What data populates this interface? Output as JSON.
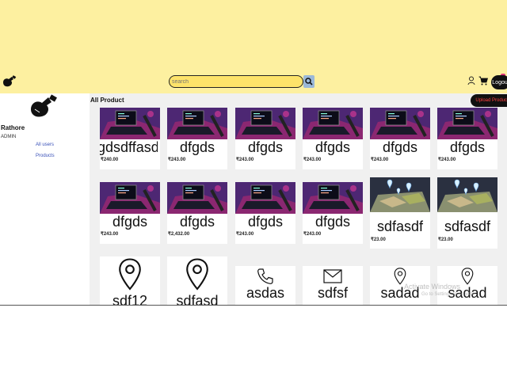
{
  "header": {
    "search_placeholder": "search",
    "logout_label": "Logout"
  },
  "sidebar": {
    "user_name": "Rathore",
    "user_role": "ADMIN",
    "links": [
      "All users",
      "Products"
    ]
  },
  "main": {
    "section_title": "All Product",
    "upload_label": "Upload Product"
  },
  "products": [
    {
      "name": "gdsdffasd",
      "price": "₹240.00",
      "image": "laptop-photo"
    },
    {
      "name": "dfgds",
      "price": "₹243.00",
      "image": "laptop-photo"
    },
    {
      "name": "dfgds",
      "price": "₹243.00",
      "image": "laptop-photo"
    },
    {
      "name": "dfgds",
      "price": "₹243.00",
      "image": "laptop-photo"
    },
    {
      "name": "dfgds",
      "price": "₹243.00",
      "image": "laptop-photo"
    },
    {
      "name": "dfgds",
      "price": "₹243.00",
      "image": "laptop-photo"
    },
    {
      "name": "dfgds",
      "price": "₹243.00",
      "image": "laptop-photo"
    },
    {
      "name": "dfgds",
      "price": "₹2,432.00",
      "image": "laptop-photo"
    },
    {
      "name": "dfgds",
      "price": "₹243.00",
      "image": "laptop-photo"
    },
    {
      "name": "dfgds",
      "price": "₹243.00",
      "image": "laptop-photo"
    },
    {
      "name": "sdfasdf",
      "price": "₹23.00",
      "image": "map-photo"
    },
    {
      "name": "sdfasdf",
      "price": "₹23.00",
      "image": "map-photo"
    },
    {
      "name": "sdf12",
      "price": "",
      "image": "location-pin-icon"
    },
    {
      "name": "sdfasd",
      "price": "",
      "image": "location-pin-icon"
    },
    {
      "name": "asdas",
      "price": "",
      "image": "phone-icon"
    },
    {
      "name": "sdfsf",
      "price": "",
      "image": "mail-icon"
    },
    {
      "name": "sadad",
      "price": "",
      "image": "location-pin-icon"
    },
    {
      "name": "sadad",
      "price": "",
      "image": "location-pin-icon"
    }
  ],
  "watermark": {
    "line1": "Activate Windows",
    "line2": "Go to Settings to activate"
  },
  "colors": {
    "header_bg": "#fdf0a0",
    "search_bg": "#fde36a",
    "main_bg": "#f0f0f0",
    "check_green": "#1aa05a",
    "upload_text": "#ff4040"
  }
}
